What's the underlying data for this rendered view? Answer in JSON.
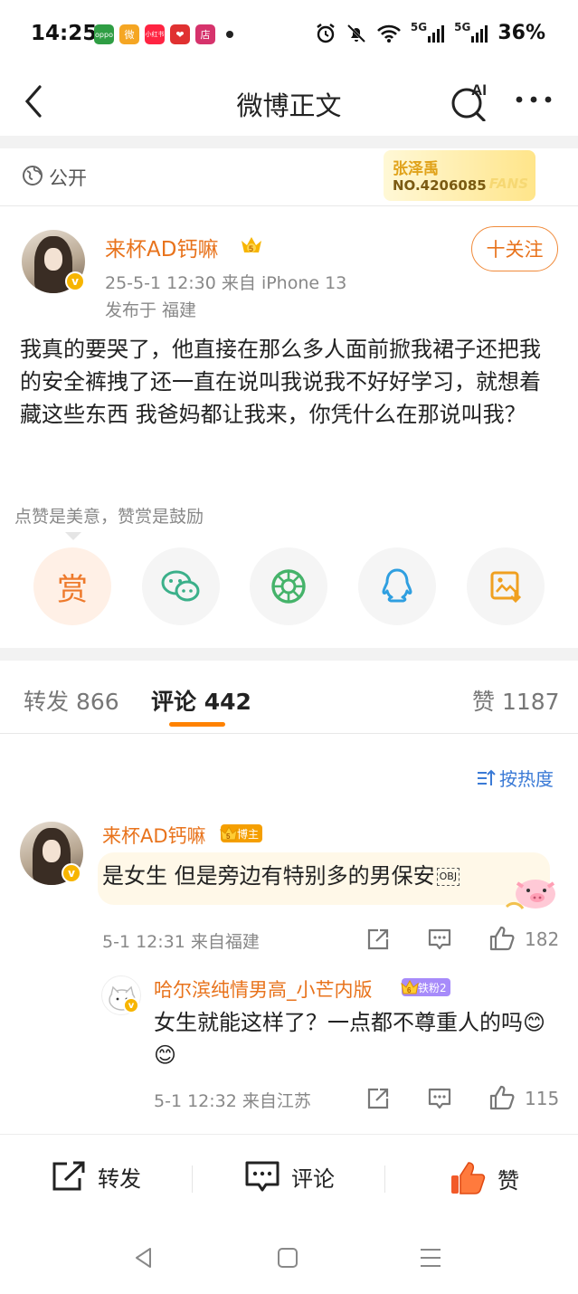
{
  "status_bar": {
    "time": "14:25",
    "app_icons": [
      {
        "name": "oppo-app-icon",
        "text": "oppo",
        "color": "#2f9e44"
      },
      {
        "name": "weibo-app-icon",
        "text": "微",
        "color": "#f5a623"
      },
      {
        "name": "xiaohongshu-app-icon",
        "text": "小红书",
        "color": "#ff2442"
      },
      {
        "name": "heart-app-icon",
        "text": "❤",
        "color": "#e03131"
      },
      {
        "name": "store-app-icon",
        "text": "店",
        "color": "#d6336c"
      }
    ],
    "network_1": "5G",
    "network_2": "5G",
    "battery": "36%"
  },
  "nav": {
    "title": "微博正文",
    "ai_label": "AI"
  },
  "post": {
    "visibility": "公开",
    "fans_card": {
      "name": "张泽禹",
      "number": "NO.4206085",
      "tag": "FANS"
    },
    "author": {
      "name": "来杯AD钙嘛",
      "level": "5"
    },
    "time_source": "25-5-1 12:30   来自 iPhone 13",
    "location": "发布于 福建",
    "follow_label": "十关注",
    "content": "我真的要哭了，他直接在那么多人面前掀我裙子还把我的安全裤拽了还一直在说叫我说我不好好学习，就想着藏这些东西 我爸妈都让我来，你凭什么在那说叫我？"
  },
  "reward": {
    "hint": "点赞是美意，赞赏是鼓励",
    "reward_char": "赏",
    "share_targets": [
      "reward",
      "wechat",
      "moments",
      "qq",
      "save-image"
    ]
  },
  "tabs": {
    "repost": "转发 866",
    "comment": "评论 442",
    "like": "赞 1187"
  },
  "sort_label": "按热度",
  "comments": [
    {
      "name": "来杯AD钙嘛",
      "badge": "博主",
      "badge_level": "5",
      "badge_color": "#f59f00",
      "text": "是女生 但是旁边有特别多的男保安",
      "obj_mark": "OBJ",
      "meta": "5-1 12:31  来自福建",
      "likes": "182"
    },
    {
      "name": "哈尔滨纯情男高_小芒内版",
      "badge": "铁粉2",
      "badge_level": "6",
      "badge_color": "#a78bfa",
      "text": "女生就能这样了？一点都不尊重人的吗😊😊",
      "meta": "5-1 12:32  来自江苏",
      "likes": "115"
    }
  ],
  "bottom_bar": {
    "repost": "转发",
    "comment": "评论",
    "like": "赞"
  },
  "colors": {
    "accent_orange": "#e8731c",
    "tab_underline": "#ff8200",
    "link_blue": "#3a7ad6"
  }
}
